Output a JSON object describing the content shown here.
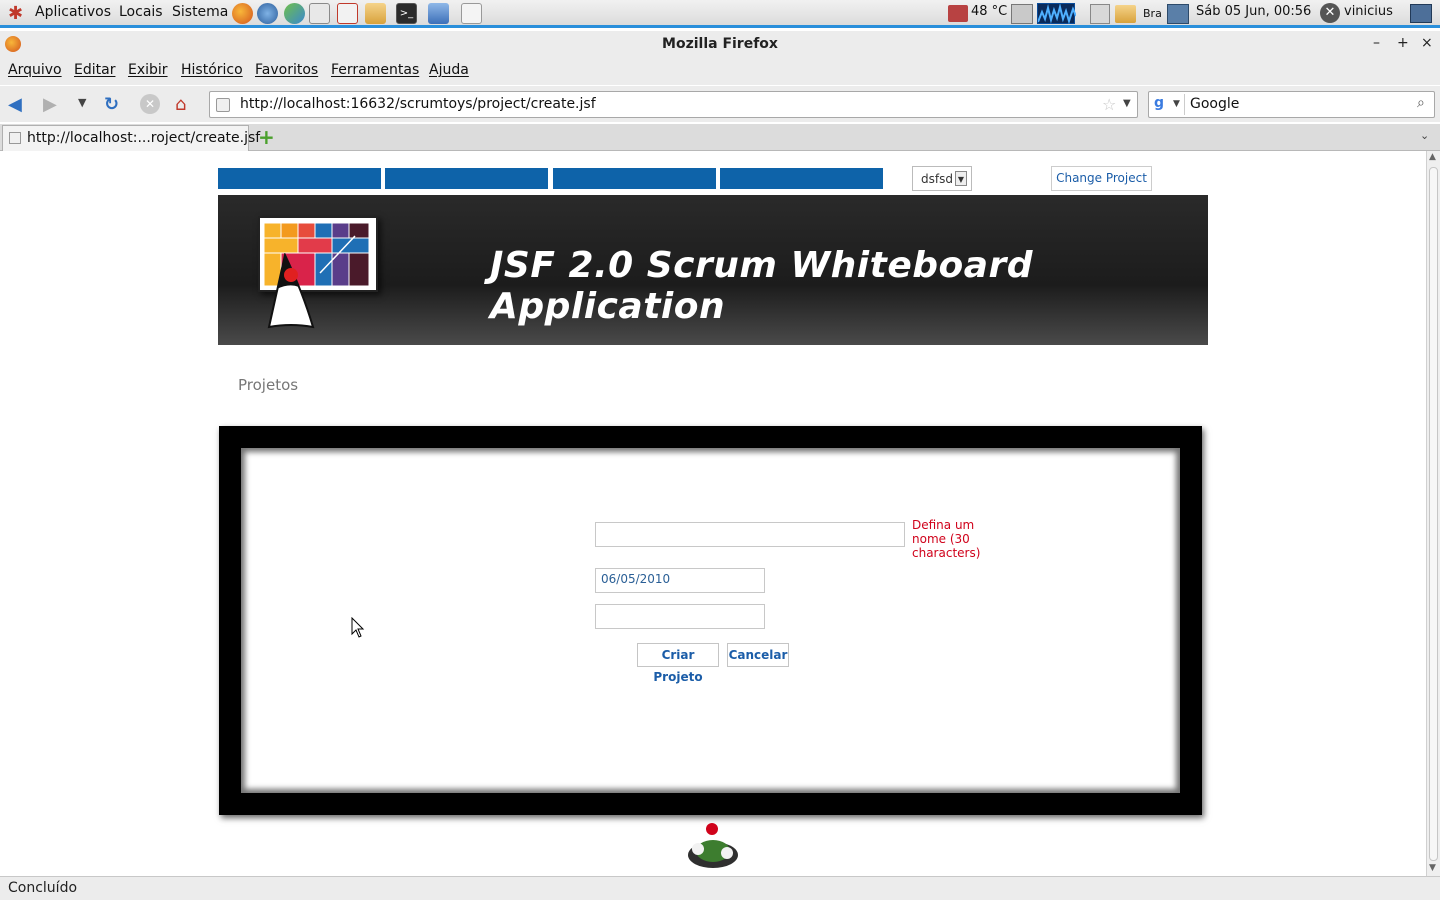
{
  "panel": {
    "menus": [
      "Aplicativos",
      "Locais",
      "Sistema"
    ],
    "temperature": "48 °C",
    "keyboard_layout": "Bra",
    "datetime": "Sáb 05 Jun, 00:56",
    "user": "vinicius"
  },
  "window": {
    "title": "Mozilla Firefox",
    "minimize": "–",
    "maximize": "+",
    "close": "×"
  },
  "menubar": [
    "Arquivo",
    "Editar",
    "Exibir",
    "Histórico",
    "Favoritos",
    "Ferramentas",
    "Ajuda"
  ],
  "navbar": {
    "url": "http://localhost:16632/scrumtoys/project/create.jsf",
    "search_engine": "Google",
    "search_placeholder": "Google"
  },
  "tabs": [
    {
      "label": "http://localhost:...roject/create.jsf",
      "active": true
    }
  ],
  "page": {
    "project_select": "dsfsd",
    "change_project": "Change Project",
    "banner_title": "JSF 2.0 Scrum Whiteboard Application",
    "breadcrumb": "Projetos",
    "form": {
      "name_value": "",
      "error_message": "Defina um nome (30 characters)",
      "start_date_value": "06/05/2010",
      "end_date_value": "",
      "submit_label": "Criar Projeto",
      "cancel_label": "Cancelar"
    }
  },
  "status": "Concluído",
  "colors": {
    "nav_blue": "#0e63a9",
    "panel_accent": "#2a8fdb",
    "error_red": "#d0021b",
    "link_blue": "#1b5da8"
  }
}
